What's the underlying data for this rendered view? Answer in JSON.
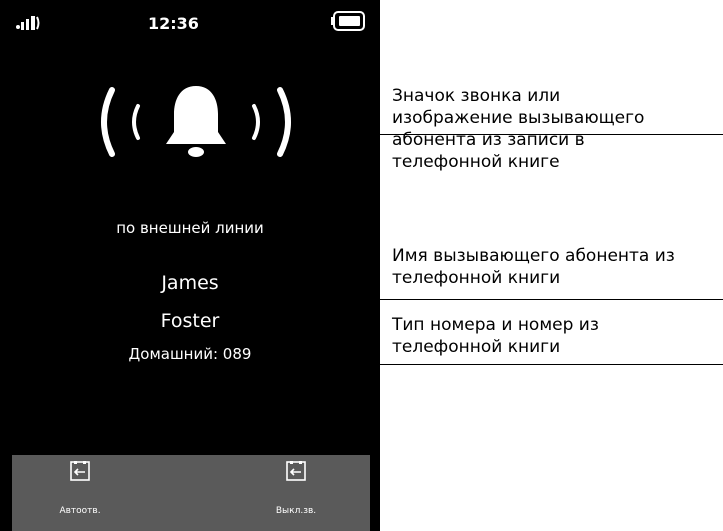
{
  "status_bar": {
    "time": "12:36",
    "signal_icon": "signal-strength-icon",
    "battery_icon": "battery-full-icon"
  },
  "call": {
    "ringer_icon": "ringing-bell-icon",
    "line_type": "по внешней линии",
    "first_name": "James",
    "last_name": "Foster",
    "number": "Домашний: 089"
  },
  "actions": [
    {
      "label": "Автоотв.",
      "icon": "auto-answer-icon"
    },
    {
      "label": "Выкл.зв.",
      "icon": "mute-ringer-icon"
    }
  ],
  "callouts": [
    {
      "lines": [
        "Значок звонка или",
        "изображение вызывающего",
        "абонента из записи в",
        "телефонной книге"
      ]
    },
    {
      "lines": [
        "Имя вызывающего абонента из",
        "телефонной книги"
      ]
    },
    {
      "lines": [
        "Тип номера и номер из",
        "телефонной книги"
      ]
    }
  ]
}
